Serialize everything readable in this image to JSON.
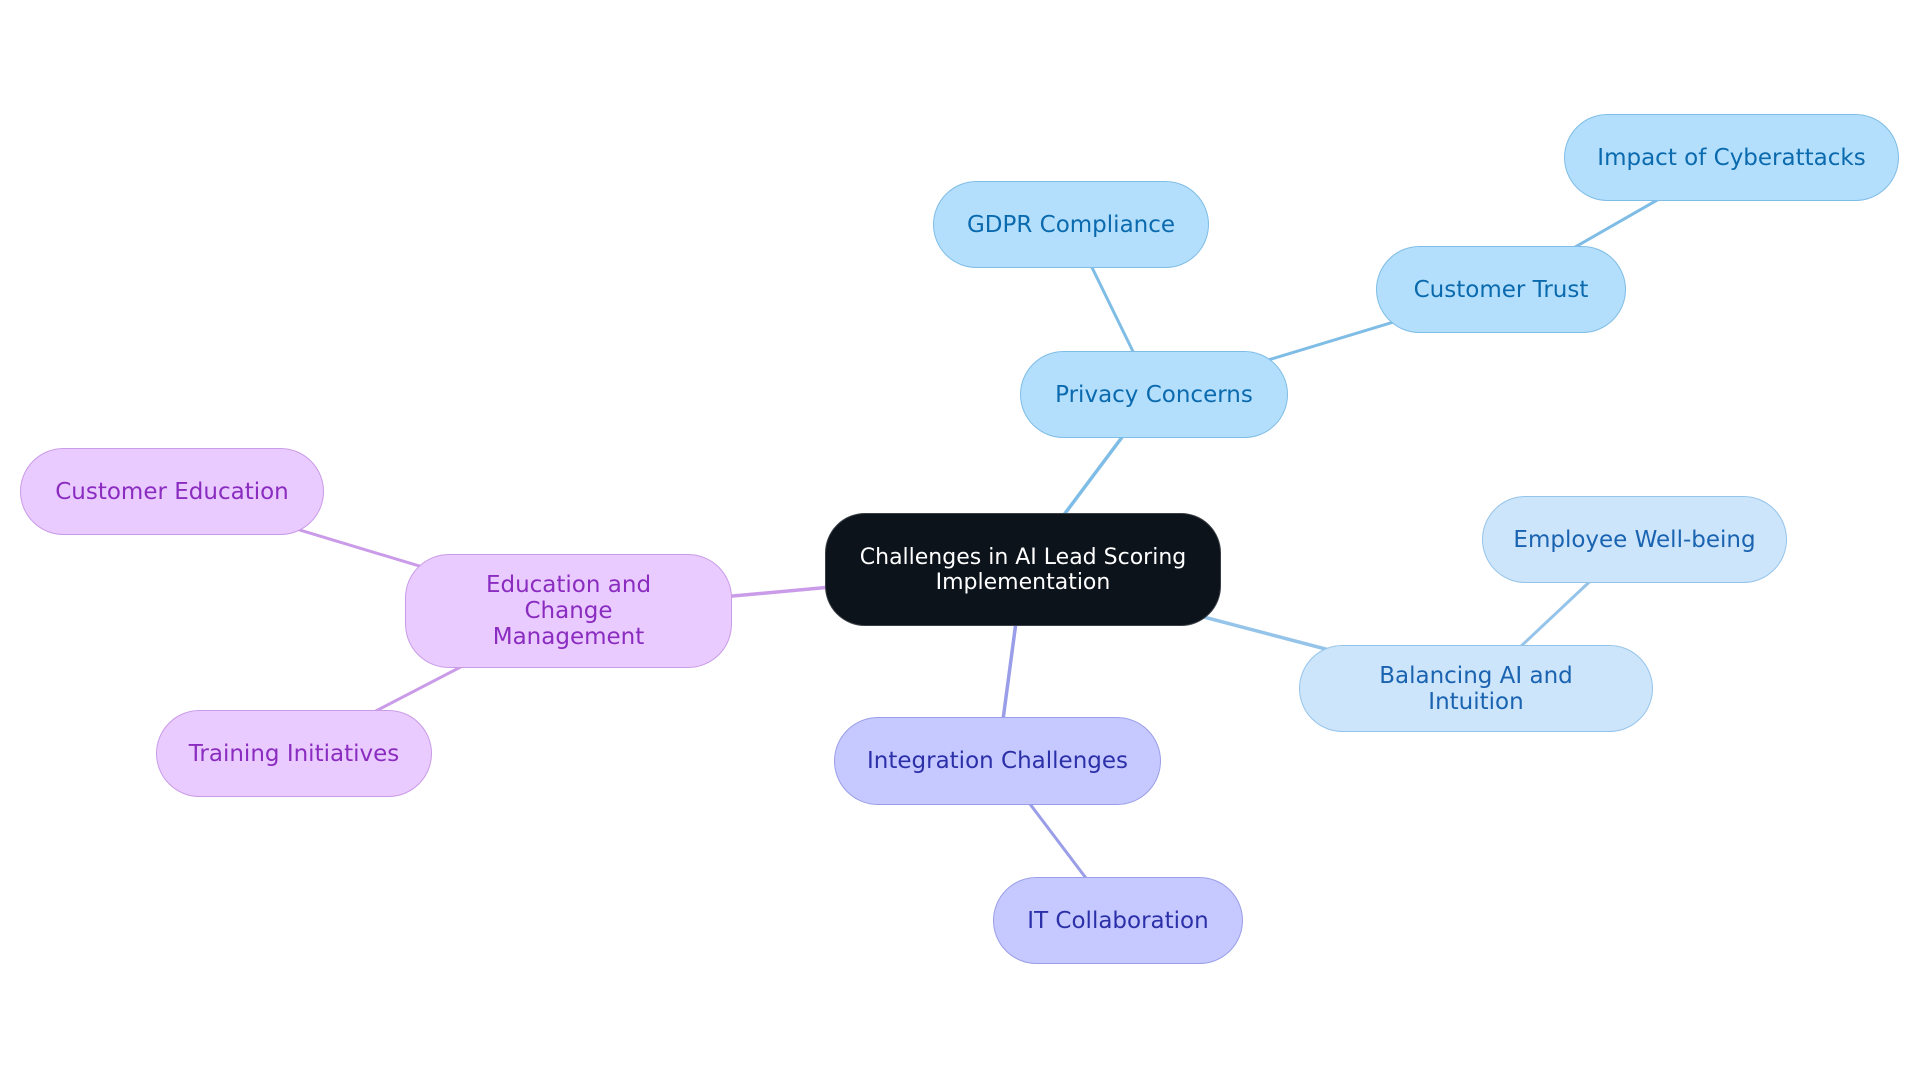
{
  "mindmap": {
    "root": {
      "id": "root",
      "label": "Challenges in AI Lead Scoring Implementation",
      "theme": "root"
    },
    "nodes": [
      {
        "id": "privacy",
        "label": "Privacy Concerns",
        "parent": "root",
        "theme": "blue"
      },
      {
        "id": "gdpr",
        "label": "GDPR Compliance",
        "parent": "privacy",
        "theme": "blue"
      },
      {
        "id": "trust",
        "label": "Customer Trust",
        "parent": "privacy",
        "theme": "blue"
      },
      {
        "id": "cyber",
        "label": "Impact of Cyberattacks",
        "parent": "trust",
        "theme": "blue"
      },
      {
        "id": "balancing",
        "label": "Balancing AI and Intuition",
        "parent": "root",
        "theme": "lightblue"
      },
      {
        "id": "wellbeing",
        "label": "Employee Well-being",
        "parent": "balancing",
        "theme": "lightblue"
      },
      {
        "id": "integration",
        "label": "Integration Challenges",
        "parent": "root",
        "theme": "indigo"
      },
      {
        "id": "itcollab",
        "label": "IT Collaboration",
        "parent": "integration",
        "theme": "indigo"
      },
      {
        "id": "education",
        "label": "Education and Change Management",
        "parent": "root",
        "theme": "purple"
      },
      {
        "id": "custed",
        "label": "Customer Education",
        "parent": "education",
        "theme": "purple"
      },
      {
        "id": "training",
        "label": "Training Initiatives",
        "parent": "education",
        "theme": "purple"
      }
    ]
  },
  "edge_colors": {
    "blue": "#7fbde6",
    "lightblue": "#95c4ea",
    "indigo": "#9a9ee8",
    "purple": "#c99be8"
  }
}
